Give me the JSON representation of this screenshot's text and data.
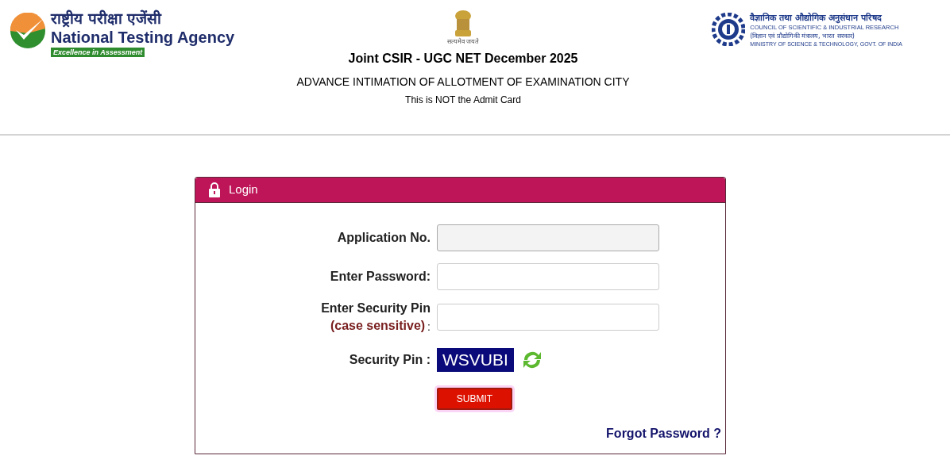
{
  "header": {
    "nta": {
      "hindi": "राष्ट्रीय परीक्षा एजेंसी",
      "english": "National Testing Agency",
      "tagline": "Excellence in Assessment"
    },
    "emblem": {
      "motto": "सत्यमेव जयते"
    },
    "title": "Joint CSIR - UGC NET December 2025",
    "subtitle": "ADVANCE INTIMATION OF ALLOTMENT OF EXAMINATION CITY",
    "note": "This is NOT the Admit Card",
    "csir": {
      "hindi": "वैज्ञानिक तथा औद्योगिक अनुसंधान परिषद",
      "english": "COUNCIL OF SCIENTIFIC & INDUSTRIAL RESEARCH",
      "ministry_hindi": "(विज्ञान एवं प्रौद्योगिकी मंत्रालय, भारत सरकार)",
      "ministry_english": "MINISTRY OF SCIENCE & TECHNOLOGY, GOVT. OF INDIA"
    }
  },
  "login": {
    "title": "Login",
    "fields": [
      {
        "label": "Application No.",
        "disabled": true
      },
      {
        "label": "Enter Password:",
        "disabled": false
      },
      {
        "label": "Enter Security Pin",
        "hint": "(case sensitive)",
        "colon": ":",
        "disabled": false
      }
    ],
    "captcha": {
      "label": "Security Pin :",
      "code": "WSVUBI"
    },
    "submit": "SUBMIT",
    "forgot": "Forgot Password ?"
  }
}
